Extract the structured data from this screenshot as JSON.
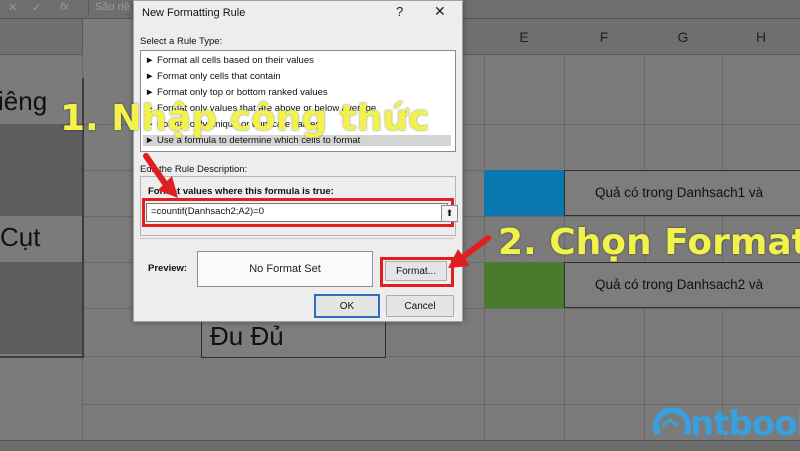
{
  "spreadsheet": {
    "formula_bar": {
      "cancel_icon": "✕",
      "enter_icon": "✓",
      "fx_label": "fx",
      "formula_preview": "Sầu riê"
    },
    "column_headers": [
      "E",
      "F",
      "G",
      "H"
    ],
    "cells": {
      "a_row1": "iêng",
      "a_row2": "Cụt",
      "d_row": "Đu Đủ",
      "legend1_text": "Quả có trong Danhsach1 và",
      "legend2_text": "Quả có trong Danhsach2 và"
    },
    "legend_colors": {
      "legend1": "#0a78b0",
      "legend2": "#4a7a2c"
    }
  },
  "dialog": {
    "title": "New Formatting Rule",
    "help_label": "?",
    "close_label": "✕",
    "rule_type_label": "Select a Rule Type:",
    "rule_types": [
      "► Format all cells based on their values",
      "► Format only cells that contain",
      "► Format only top or bottom ranked values",
      "► Format only values that are above or below average",
      "► Format only unique or duplicate values",
      "► Use a formula to determine which cells to format"
    ],
    "edit_label": "Edit the Rule Description:",
    "formula_label": "Format values where this formula is true:",
    "formula_value": "=countif(Danhsach2;A2)=0",
    "collapse_icon": "⬆",
    "preview_label": "Preview:",
    "preview_text": "No Format Set",
    "format_button": "Format...",
    "ok_button": "OK",
    "cancel_button": "Cancel"
  },
  "annotations": {
    "step1": "1. Nhập công thức",
    "step2": "2. Chọn Format",
    "arrow_color": "#e02020",
    "text_color": "#f2f24b"
  },
  "logo": {
    "text": "ntbook"
  }
}
